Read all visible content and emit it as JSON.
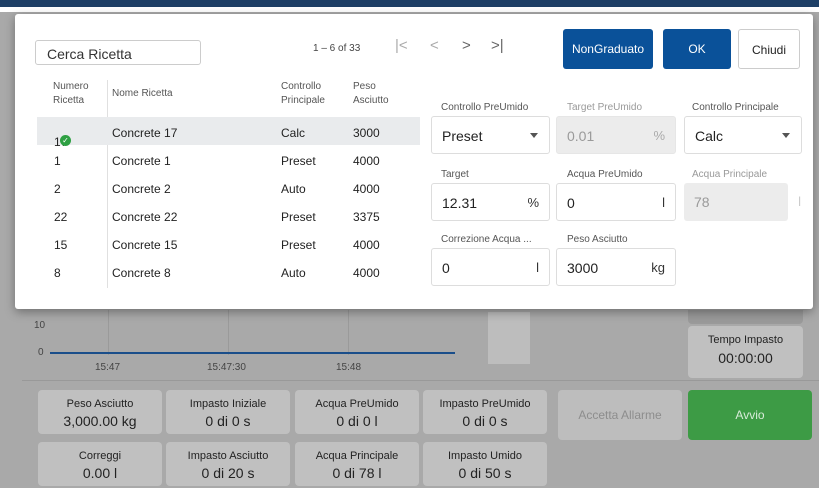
{
  "background": {
    "chart": {
      "y_ticks": [
        "10",
        "0"
      ],
      "x_ticks": [
        "15:47",
        "15:47:30",
        "15:48"
      ]
    },
    "tempo_impasto": {
      "label": "Tempo Impasto",
      "value": "00:00:00"
    },
    "stats": [
      {
        "label": "Peso Asciutto",
        "value": "3,000.00 kg"
      },
      {
        "label": "Impasto Iniziale",
        "value": "0 di 0 s"
      },
      {
        "label": "Acqua PreUmido",
        "value": "0 di 0 l"
      },
      {
        "label": "Impasto PreUmido",
        "value": "0 di 0 s"
      },
      {
        "label": "Correggi",
        "value": "0.00 l"
      },
      {
        "label": "Impasto Asciutto",
        "value": "0 di 20 s"
      },
      {
        "label": "Acqua Principale",
        "value": "0 di 78 l"
      },
      {
        "label": "Impasto Umido",
        "value": "0 di 50 s"
      }
    ],
    "accetta_allarme": "Accetta Allarme",
    "avvio": "Avvio",
    "colors": {
      "avvio": "#3d9b45",
      "accent": "#0a5199",
      "disabled": "#bdbdbd"
    }
  },
  "dialog": {
    "search_placeholder": "Cerca Ricetta",
    "pagination": {
      "range": "1 – 6 of 33",
      "first": "|<",
      "prev": "<",
      "next": ">",
      "last": ">|"
    },
    "table": {
      "headers": {
        "numero": "Numero Ricetta",
        "nome": "Nome Ricetta",
        "controllo": "Controllo Principale",
        "peso": "Peso Asciutto"
      },
      "rows": [
        {
          "numero": "17",
          "nome": "Concrete 17",
          "controllo": "Calc",
          "peso": "3000",
          "selected": true
        },
        {
          "numero": "1",
          "nome": "Concrete 1",
          "controllo": "Preset",
          "peso": "4000"
        },
        {
          "numero": "2",
          "nome": "Concrete 2",
          "controllo": "Auto",
          "peso": "4000"
        },
        {
          "numero": "22",
          "nome": "Concrete 22",
          "controllo": "Preset",
          "peso": "3375"
        },
        {
          "numero": "15",
          "nome": "Concrete 15",
          "controllo": "Preset",
          "peso": "4000"
        },
        {
          "numero": "8",
          "nome": "Concrete 8",
          "controllo": "Auto",
          "peso": "4000"
        }
      ]
    },
    "buttons": {
      "non_graduato": "NonGraduato",
      "ok": "OK",
      "chiudi": "Chiudi"
    },
    "fields": {
      "controllo_preumido": {
        "label": "Controllo PreUmido",
        "value": "Preset"
      },
      "target_preumido": {
        "label": "Target PreUmido",
        "value": "0.01",
        "unit": "%"
      },
      "controllo_principale": {
        "label": "Controllo Principale",
        "value": "Calc"
      },
      "target": {
        "label": "Target",
        "value": "12.31",
        "unit": "%"
      },
      "acqua_preumido": {
        "label": "Acqua PreUmido",
        "value": "0",
        "unit": "l"
      },
      "acqua_principale": {
        "label": "Acqua Principale",
        "value": "78",
        "unit": "l"
      },
      "correzione_acqua": {
        "label": "Correzione Acqua ...",
        "value": "0",
        "unit": "l"
      },
      "peso_asciutto": {
        "label": "Peso Asciutto",
        "value": "3000",
        "unit": "kg"
      }
    }
  }
}
